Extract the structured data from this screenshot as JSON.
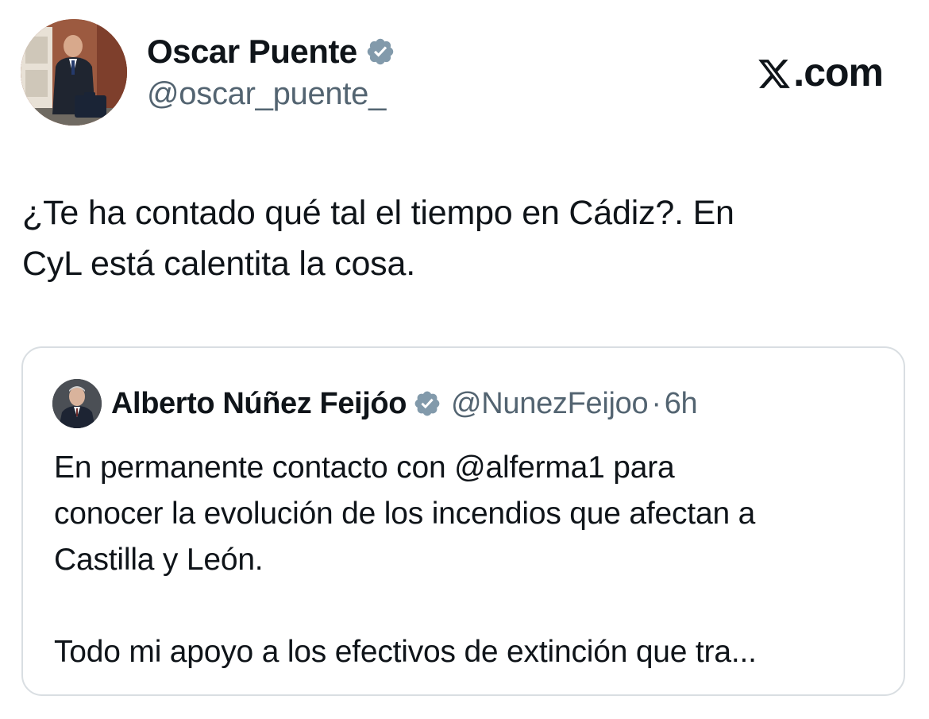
{
  "author": {
    "display_name": "Oscar Puente",
    "handle": "@oscar_puente_",
    "verified_icon": "verified-badge-icon",
    "avatar_icon": "profile-photo"
  },
  "brand": {
    "suffix": ".com",
    "logo_icon": "x-logo-icon"
  },
  "tweet": {
    "line_1": "¿Te ha contado qué tal el tiempo en Cádiz?. En",
    "line_2": "CyL está calentita la cosa."
  },
  "quoted_tweet": {
    "display_name": "Alberto Núñez Feijóo",
    "handle": "@NunezFeijoo",
    "separator": "·",
    "time": "6h",
    "line_1": "En permanente contacto con @alferma1 para",
    "line_2": "conocer la evolución de los incendios que afectan a",
    "line_3": "Castilla y León.",
    "line_4": "Todo mi apoyo a los efectivos de extinción que tra..."
  },
  "colors": {
    "text": "#0f1419",
    "secondary_text": "#536471",
    "verified_gray": "#829aab",
    "card_border": "#d9dee2"
  }
}
